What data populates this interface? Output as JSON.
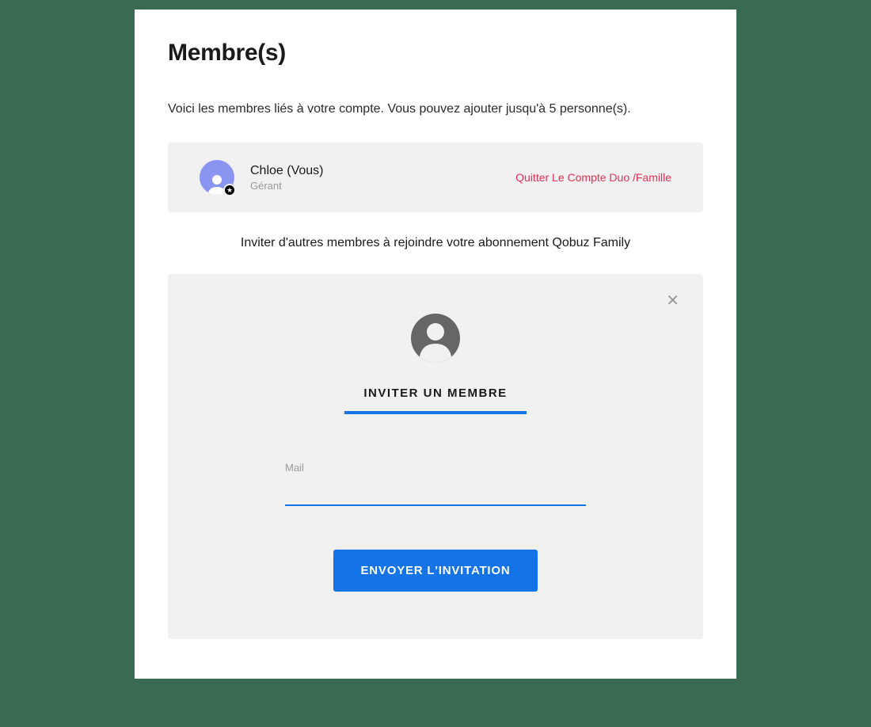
{
  "page": {
    "title": "Membre(s)",
    "subtitle": "Voici les membres liés à votre compte. Vous pouvez ajouter jusqu'à 5 personne(s)."
  },
  "member": {
    "name": "Chloe (Vous)",
    "role": "Gérant",
    "leave_link": "Quitter Le Compte Duo /Famille"
  },
  "invite": {
    "intro_text": "Inviter d'autres membres à rejoindre votre abonnement Qobuz Family",
    "heading": "INVITER UN MEMBRE",
    "mail_label": "Mail",
    "mail_value": "",
    "submit_label": "ENVOYER L'INVITATION"
  }
}
